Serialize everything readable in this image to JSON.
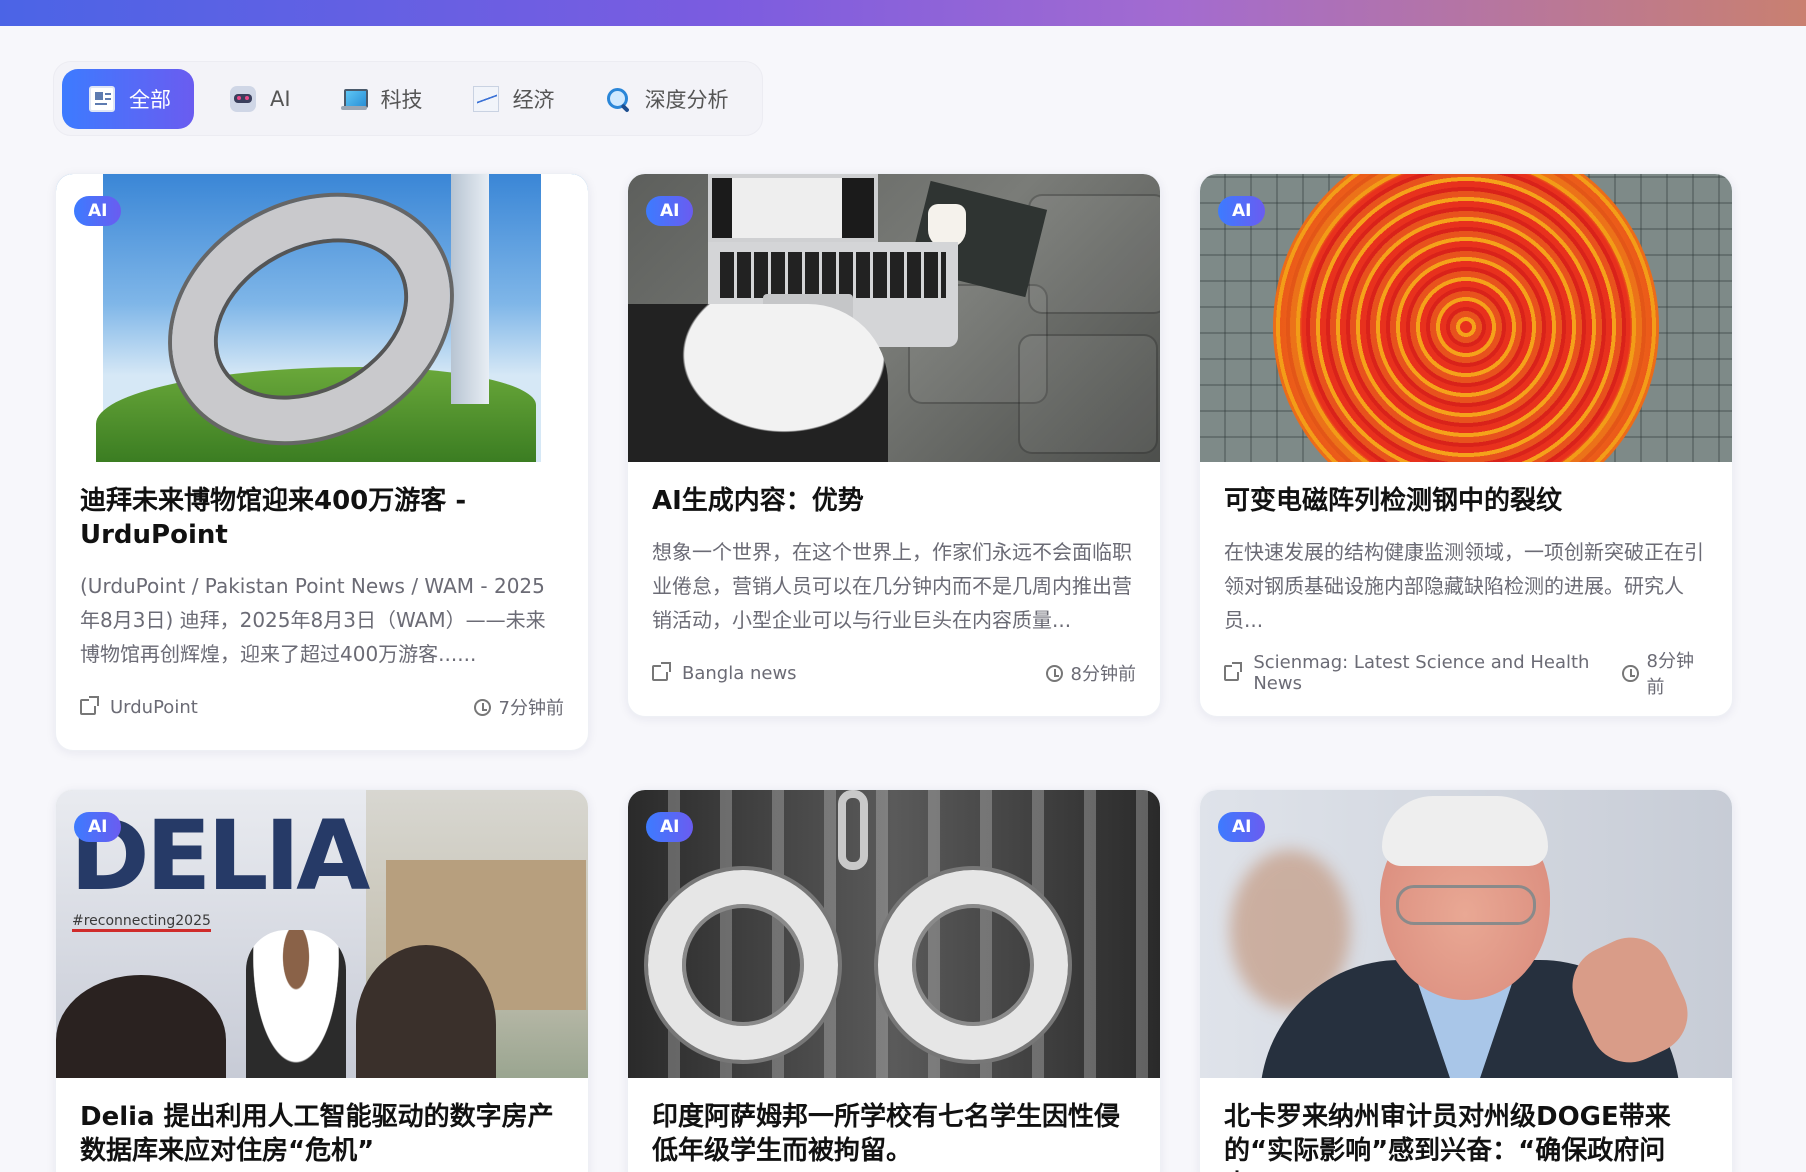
{
  "tabs": [
    {
      "label": "全部",
      "icon": "newspaper-icon",
      "active": true
    },
    {
      "label": "AI",
      "icon": "robot-icon",
      "active": false
    },
    {
      "label": "科技",
      "icon": "laptop-icon",
      "active": false
    },
    {
      "label": "经济",
      "icon": "chart-increasing-icon",
      "active": false
    },
    {
      "label": "深度分析",
      "icon": "magnifier-icon",
      "active": false
    }
  ],
  "cards": [
    {
      "badge": "AI",
      "title": "迪拜未来博物馆迎来400万游客 - UrduPoint",
      "desc": "(UrduPoint / Pakistan Point News / WAM - 2025年8月3日) 迪拜，2025年8月3日（WAM）——未来博物馆再创辉煌，迎来了超过400万游客......",
      "source": "UrduPoint",
      "time": "7分钟前"
    },
    {
      "badge": "AI",
      "title": "AI生成内容：优势",
      "desc": "想象一个世界，在这个世界上，作家们永远不会面临职业倦怠，营销人员可以在几分钟内而不是几周内推出营销活动，小型企业可以与行业巨头在内容质量...",
      "source": "Bangla news",
      "time": "8分钟前"
    },
    {
      "badge": "AI",
      "title": "可变电磁阵列检测钢中的裂纹",
      "desc": "在快速发展的结构健康监测领域，一项创新突破正在引领对钢质基础设施内部隐藏缺陷检测的进展。研究人员...",
      "source": "Scienmag: Latest Science and Health News",
      "time": "8分钟前"
    },
    {
      "badge": "AI",
      "title": "Delia 提出利用人工智能驱动的数字房产数据库来应对住房“危机”",
      "banner_text": "DELIA",
      "hashtag": "#reconnecting2025"
    },
    {
      "badge": "AI",
      "title": "印度阿萨姆邦一所学校有七名学生因性侵低年级学生而被拘留。"
    },
    {
      "badge": "AI",
      "title": "北卡罗来纳州审计员对州级DOGE带来的“实际影响”感到兴奋：“确保政府问责”"
    }
  ],
  "colors": {
    "accent_start": "#3d7bff",
    "accent_end": "#6a5cf0",
    "background": "#f7f7fb"
  }
}
